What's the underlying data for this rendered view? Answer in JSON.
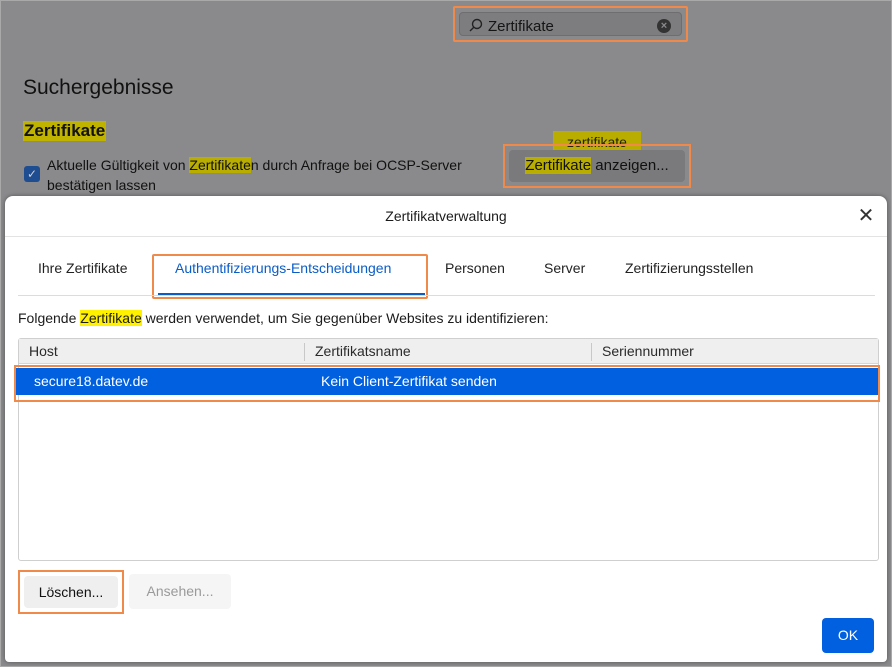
{
  "background": {
    "search": {
      "value": "Zertifikate"
    },
    "results_title": "Suchergebnisse",
    "section_title": "Zertifikate",
    "ocsp": {
      "checked": true,
      "text_before": "Aktuelle Gültigkeit von ",
      "highlight": "Zertifikate",
      "text_after": "n durch Anfrage bei OCSP-Server bestätigen lassen"
    },
    "tooltip_label": "zertifikate",
    "show_button": {
      "highlight": "Zertifikate",
      "rest": " anzeigen..."
    }
  },
  "dialog": {
    "title": "Zertifikatverwaltung",
    "tabs": [
      {
        "label": "Ihre Zertifikate",
        "active": false
      },
      {
        "label": "Authentifizierungs-Entscheidungen",
        "active": true
      },
      {
        "label": "Personen",
        "active": false
      },
      {
        "label": "Server",
        "active": false
      },
      {
        "label": "Zertifizierungsstellen",
        "active": false
      }
    ],
    "info": {
      "before": "Folgende ",
      "highlight": "Zertifikate",
      "after": " werden verwendet, um Sie gegenüber Websites zu identifizieren:"
    },
    "table": {
      "columns": [
        "Host",
        "Zertifikatsname",
        "Seriennummer"
      ],
      "rows": [
        {
          "host": "secure18.datev.de",
          "cert_name": "Kein Client-Zertifikat senden",
          "serial": ""
        }
      ]
    },
    "buttons": {
      "delete": "Löschen...",
      "view": "Ansehen...",
      "ok": "OK"
    }
  },
  "colors": {
    "accent": "#0060df",
    "highlight_callout": "#f08a4b",
    "search_highlight": "#fff100"
  }
}
